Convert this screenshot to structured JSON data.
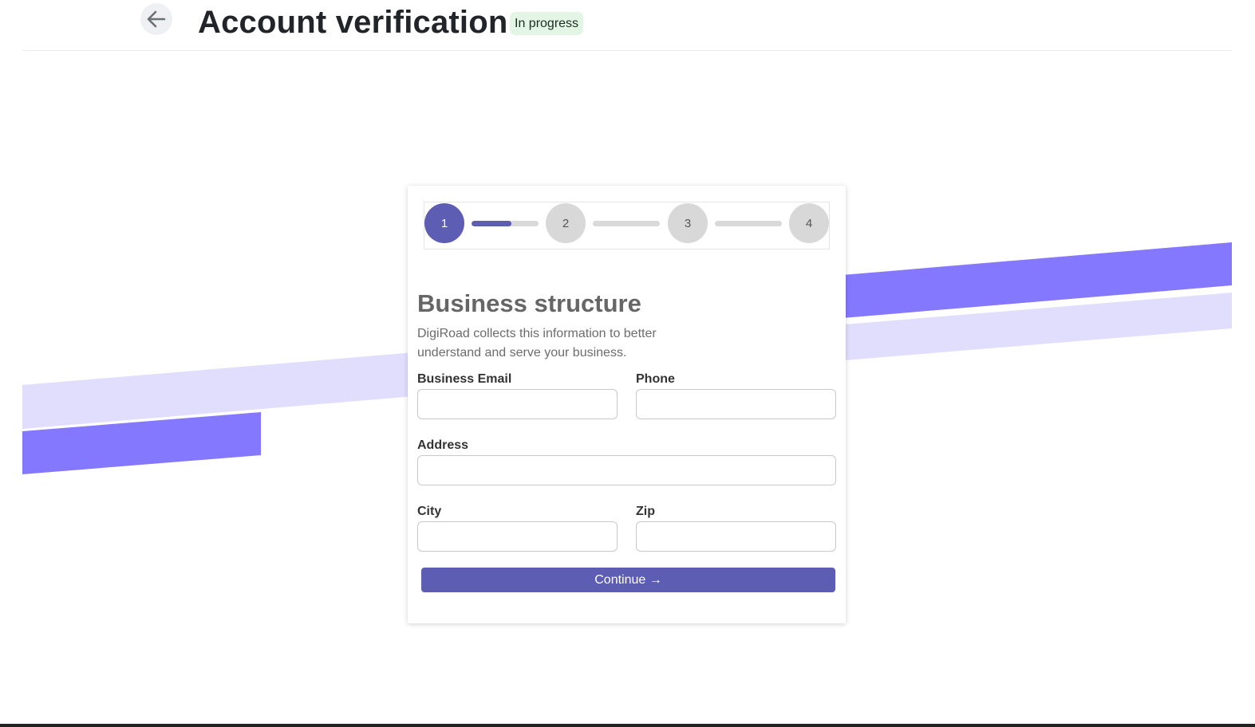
{
  "header": {
    "title": "Account verification",
    "status": "In progress",
    "back_icon": "arrow-left-icon"
  },
  "stepper": {
    "steps": [
      "1",
      "2",
      "3",
      "4"
    ],
    "current_step": 1,
    "progress": [
      0.6,
      0,
      0
    ]
  },
  "form": {
    "title": "Business structure",
    "description": "DigiRoad collects this information to better understand and serve your business.",
    "fields": {
      "business_email": {
        "label": "Business Email",
        "value": ""
      },
      "phone": {
        "label": "Phone",
        "value": ""
      },
      "address": {
        "label": "Address",
        "value": ""
      },
      "city": {
        "label": "City",
        "value": ""
      },
      "zip": {
        "label": "Zip",
        "value": ""
      }
    },
    "continue_label": "Continue →"
  },
  "colors": {
    "accent": "#5c5db3",
    "stripe_dark": "#8478ff",
    "stripe_light": "#e1defd",
    "badge_bg": "#e3f6e5"
  }
}
